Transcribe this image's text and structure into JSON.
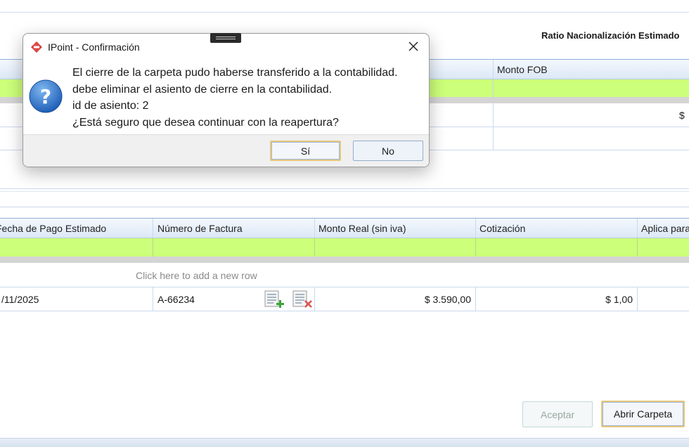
{
  "top_section": {
    "ratio_label": "Ratio Nacionalización Estimado",
    "columns": [
      "Monto FOB"
    ],
    "row1_value": "$"
  },
  "bottom_grid": {
    "columns": [
      "Fecha de Pago Estimado",
      "Número de Factura",
      "Monto Real (sin iva)",
      "Cotización",
      "Aplica para"
    ],
    "add_row_text": "Click here to add a new row",
    "rows": [
      {
        "fecha": "/11/2025",
        "factura": "A-66234",
        "monto": "$ 3.590,00",
        "cotizacion": "$ 1,00",
        "aplica": ""
      }
    ]
  },
  "footer": {
    "aceptar_label": "Aceptar",
    "abrir_label": "Abrir Carpeta"
  },
  "dialog": {
    "title": "IPoint - Confirmación",
    "message_lines": [
      "El cierre de la carpeta pudo haberse transferido a la contabilidad.",
      "debe eliminar el asiento de cierre en la contabilidad.",
      "id de asiento: 2",
      "¿Está seguro que desea continuar con la reapertura?"
    ],
    "yes_label": "Sí",
    "no_label": "No"
  },
  "icons": {
    "app_icon": "sale-tag-icon",
    "question_icon": "question-mark-icon",
    "add_icon": "add-document-icon",
    "delete_icon": "delete-document-icon",
    "close_icon": "close-icon"
  },
  "colors": {
    "filter_row": "#ccff7a",
    "header_gradient_bottom": "#dce8f6",
    "default_button_border": "#e8c77a"
  }
}
